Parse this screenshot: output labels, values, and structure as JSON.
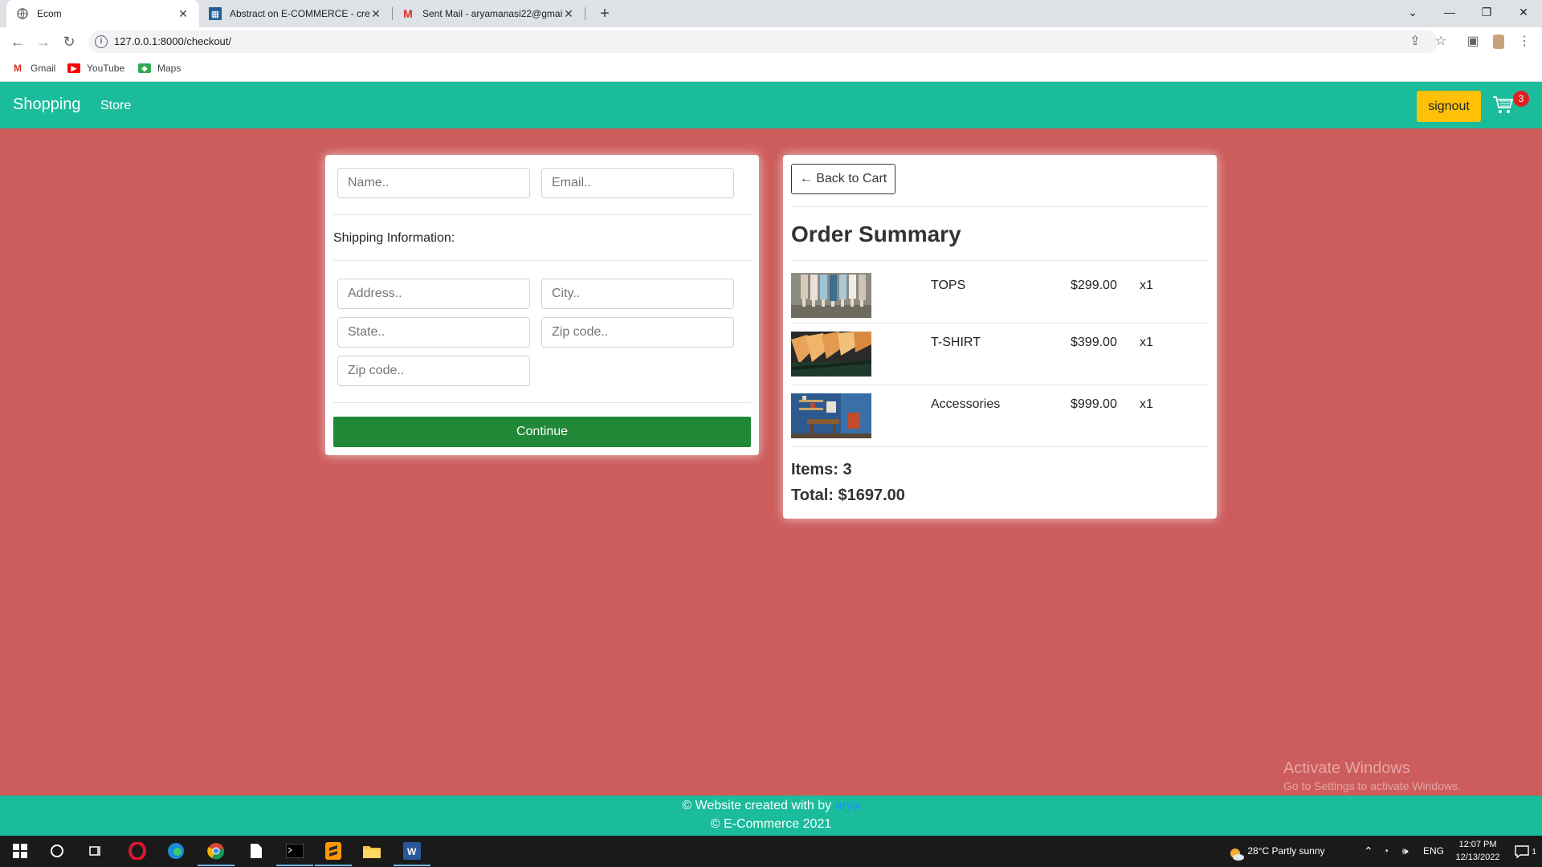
{
  "browser": {
    "tabs": [
      {
        "title": "Ecom",
        "active": true
      },
      {
        "title": "Abstract on E-COMMERCE - crea",
        "active": false
      },
      {
        "title": "Sent Mail - aryamanasi22@gmai",
        "active": false
      }
    ],
    "url": "127.0.0.1:8000/checkout/",
    "bookmarks": [
      "Gmail",
      "YouTube",
      "Maps"
    ]
  },
  "navbar": {
    "brand": "Shopping",
    "store_link": "Store",
    "signout_label": "signout",
    "cart_count": "3"
  },
  "form": {
    "name_placeholder": "Name..",
    "email_placeholder": "Email..",
    "shipping_label": "Shipping Information:",
    "address_placeholder": "Address..",
    "city_placeholder": "City..",
    "state_placeholder": "State..",
    "zip_placeholder": "Zip code..",
    "zip2_placeholder": "Zip code..",
    "continue_label": "Continue"
  },
  "summary": {
    "back_label": "← Back to Cart",
    "title": "Order Summary",
    "items": [
      {
        "name": "TOPS",
        "price": "$299.00",
        "qty": "x1"
      },
      {
        "name": "T-SHIRT",
        "price": "$399.00",
        "qty": "x1"
      },
      {
        "name": "Accessories",
        "price": "$999.00",
        "qty": "x1"
      }
    ],
    "items_count": "Items: 3",
    "total": "Total: $1697.00"
  },
  "footer": {
    "created_prefix": "© Website created with by",
    "author": "arya",
    "copyright": "© E-Commerce 2021"
  },
  "watermark": {
    "line1": "Activate Windows",
    "line2": "Go to Settings to activate Windows."
  },
  "taskbar": {
    "weather": "28°C  Partly sunny",
    "lang": "ENG",
    "time": "12:07 PM",
    "date": "12/13/2022",
    "notifications": "1"
  },
  "colors": {
    "page_bg": "#cd5c5c",
    "nav_bg": "#1abc9c",
    "signout_bg": "#ffc107",
    "continue_bg": "#218838"
  }
}
